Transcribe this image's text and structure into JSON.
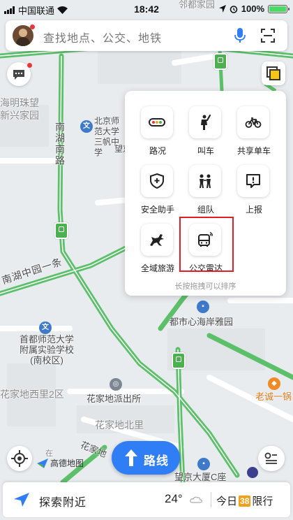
{
  "status_bar": {
    "carrier": "中国联通",
    "time": "18:42",
    "battery": "100%"
  },
  "search": {
    "placeholder": "查找地点、公交、地铁"
  },
  "map_labels": {
    "top_right": "邻都家园",
    "haiming": "海明珠望",
    "xinxing": "新兴家园",
    "nanhu_road": "南湖南路",
    "bnu": "北京师范大学三帆中学",
    "wangjing_fragment": "望京",
    "nanhu_zhong": "南湖中园一条",
    "dushi": "都市心海岸雅园",
    "cnu": "首都师范大学附属实验学校(南校区)",
    "huajiadi_2": "花家地西里2区",
    "police": "花家地派出所",
    "huajiadi_beili": "花家地北里",
    "huajiadi_street": "花家地",
    "laocheng": "老诚一锅",
    "wangjing_c": "望京大厦C座",
    "zai": "在"
  },
  "tools": {
    "items": [
      {
        "label": "路况",
        "icon": "traffic-icon"
      },
      {
        "label": "叫车",
        "icon": "hail-taxi-icon"
      },
      {
        "label": "共享单车",
        "icon": "bike-icon"
      },
      {
        "label": "安全助手",
        "icon": "shield-plus-icon"
      },
      {
        "label": "组队",
        "icon": "team-icon"
      },
      {
        "label": "上报",
        "icon": "report-icon"
      },
      {
        "label": "全域旅游",
        "icon": "horse-icon"
      },
      {
        "label": "公交雷达",
        "icon": "bus-radar-icon"
      }
    ],
    "hint": "长按拖拽可以排序"
  },
  "route": {
    "label": "路线"
  },
  "logo": {
    "text": "高德地图"
  },
  "bottom": {
    "explore": "探索附近",
    "temperature": "24°",
    "limit_prefix": "今日",
    "limit_plates": "38",
    "limit_suffix": "限行"
  },
  "colors": {
    "accent": "#2f7ef5",
    "highlight": "#e01e26",
    "road_green": "#5cc06a",
    "plate": "#f0a11b"
  }
}
